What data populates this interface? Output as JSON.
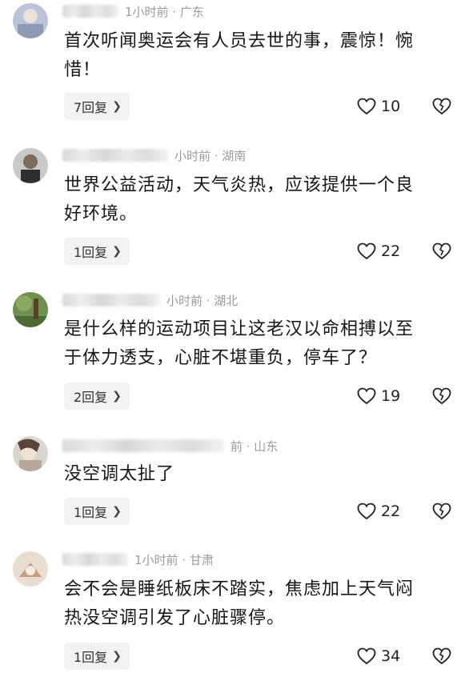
{
  "comments": [
    {
      "time": "1小时前 · 广东",
      "text_lines": [
        "首次听闻奥运会有人员去世的事，震惊！惋",
        "惜！"
      ],
      "reply_label": "7回复",
      "likes": "10"
    },
    {
      "time": "小时前 · 湖南",
      "text_lines": [
        "世界公益活动，天气炎热，应该提供一个良",
        "好环境。"
      ],
      "reply_label": "1回复",
      "likes": "22"
    },
    {
      "time": "小时前 · 湖北",
      "text_lines": [
        "是什么样的运动项目让这老汉以命相搏以至",
        "于体力透支，心脏不堪重负，停车了？"
      ],
      "reply_label": "2回复",
      "likes": "19"
    },
    {
      "time": "前 · 山东",
      "text_lines": [
        "没空调太扯了"
      ],
      "reply_label": "1回复",
      "likes": "22"
    },
    {
      "time": "1小时前 · 甘肃",
      "text_lines": [
        "会不会是睡纸板床不踏实，焦虑加上天气闷",
        "热没空调引发了心脏骤停。"
      ],
      "reply_label": "1回复",
      "likes": "34"
    }
  ],
  "icons": {
    "like": "heart-outline-icon",
    "dislike": "broken-heart-icon",
    "reply": "chevron-right-icon"
  },
  "colors": {
    "time": "#9a9a9a",
    "reply_bg": "#f2f2f2"
  }
}
